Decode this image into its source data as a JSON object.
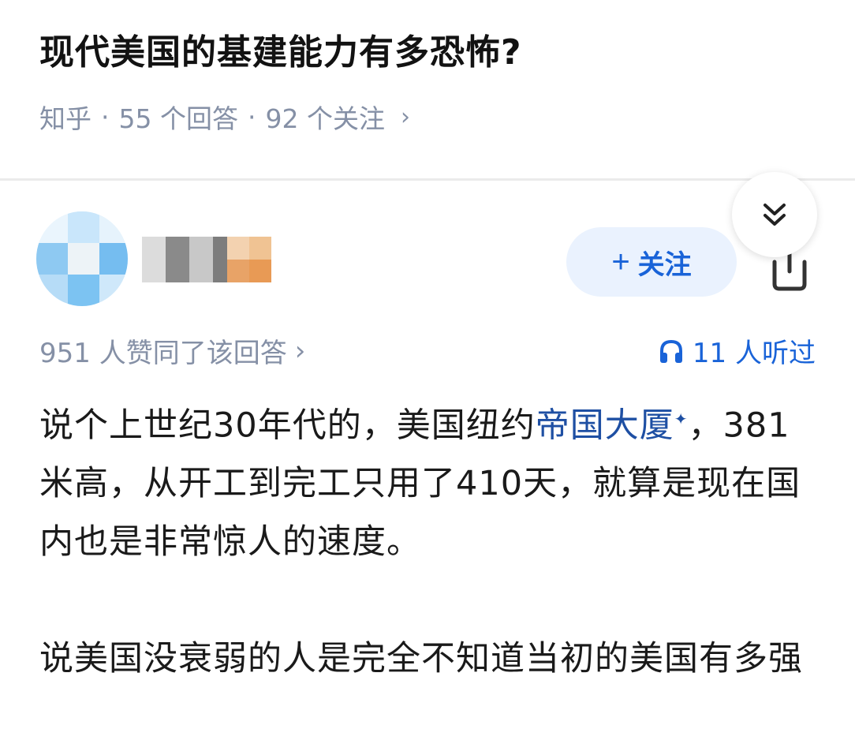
{
  "question": {
    "title": "现代美国的基建能力有多恐怖?",
    "source": "知乎",
    "separator": "·",
    "answers": "55 个回答",
    "followers": "92 个关注",
    "chevron": "›"
  },
  "answer": {
    "follow_button": {
      "plus": "+",
      "label": "关注"
    },
    "share_icon": "share-icon",
    "collapse_icon": "double-chevron-down-icon",
    "votes": "951 人赞同了该回答",
    "votes_chevron": "›",
    "listen": "11 人听过",
    "listen_icon": "headphones-icon",
    "accent_color": "#1963d8",
    "link_color": "#1e4fa3",
    "paragraph1": {
      "before_link": "说个上世纪30年代的，美国纽约",
      "link": "帝国大厦",
      "link_mark": "✦",
      "after_link": "，381米高，从开工到完工只用了410天，就算是现在国内也是非常惊人的速度。"
    },
    "paragraph2": "说美国没衰弱的人是完全不知道当初的美国有多强"
  }
}
